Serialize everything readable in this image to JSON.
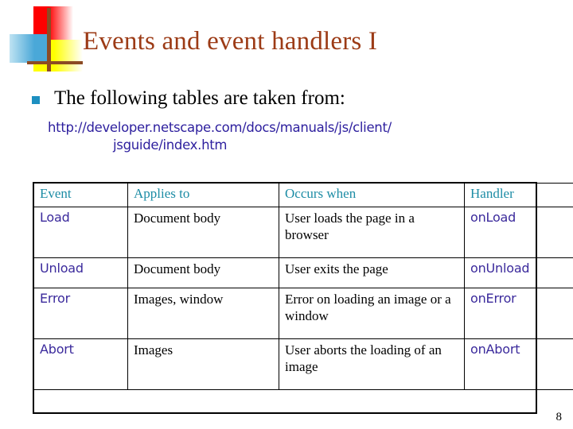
{
  "slide": {
    "title": "Events and event handlers I",
    "page_number": "8",
    "title_color": "#9c3b16"
  },
  "logo": {
    "red_color": "#fe0000",
    "yellow_color": "#ffff00",
    "blue_color": "#4aa8d8",
    "cross_color": "#8c4b24"
  },
  "bullet": {
    "marker_color": "#1d8fc0",
    "text": "The following tables are taken from:"
  },
  "url": {
    "line1": "http://developer.netscape.com/docs/manuals/js/client/",
    "line2": "jsguide/index.htm",
    "color": "#2d1f9e"
  },
  "table": {
    "header_color": "#1c8ca5",
    "code_color": "#3b2a9c",
    "headers": [
      "Event",
      "Applies to",
      "Occurs when",
      "Handler"
    ],
    "rows": [
      {
        "event": "Load",
        "applies_to": "Document body",
        "occurs_when": "User loads the page in a browser",
        "handler": "onLoad",
        "tall": true
      },
      {
        "event": "Unload",
        "applies_to": "Document body",
        "occurs_when": "User exits the page",
        "handler": "onUnload",
        "tall": false
      },
      {
        "event": "Error",
        "applies_to": "Images, window",
        "occurs_when": "Error on loading an image or a window",
        "handler": "onError",
        "tall": true
      },
      {
        "event": "Abort",
        "applies_to": "Images",
        "occurs_when": "User aborts the loading of an image",
        "handler": "onAbort",
        "tall": true
      }
    ]
  }
}
